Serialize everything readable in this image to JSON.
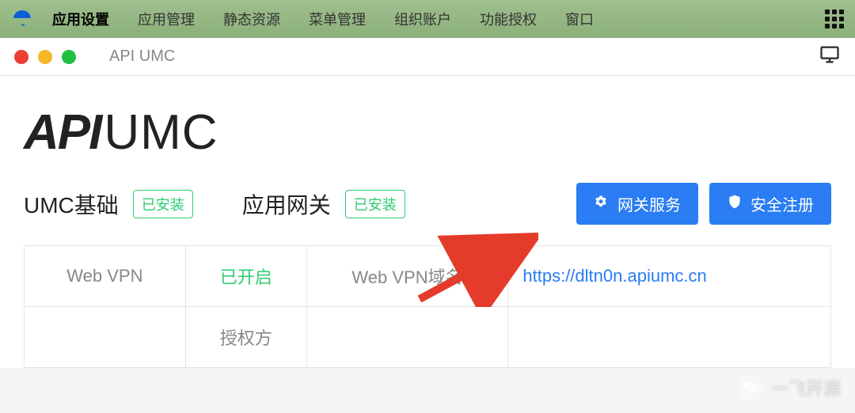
{
  "menubar": {
    "items": [
      {
        "label": "应用设置",
        "active": true
      },
      {
        "label": "应用管理"
      },
      {
        "label": "静态资源"
      },
      {
        "label": "菜单管理"
      },
      {
        "label": "组织账户"
      },
      {
        "label": "功能授权"
      },
      {
        "label": "窗口"
      }
    ]
  },
  "window": {
    "title": "API UMC"
  },
  "brand": {
    "api": "API",
    "umc": "UMC"
  },
  "status": {
    "umc_label": "UMC基础",
    "umc_tag": "已安装",
    "gateway_label": "应用网关",
    "gateway_tag": "已安装"
  },
  "actions": {
    "gateway_service": "网关服务",
    "secure_register": "安全注册"
  },
  "table": {
    "row1": {
      "col1": "Web VPN",
      "col2": "已开启",
      "col3": "Web VPN域名",
      "col4": "https://dltn0n.apiumc.cn"
    },
    "row2": {
      "col2": "授权方"
    }
  },
  "watermark": {
    "text": "一飞开源"
  }
}
